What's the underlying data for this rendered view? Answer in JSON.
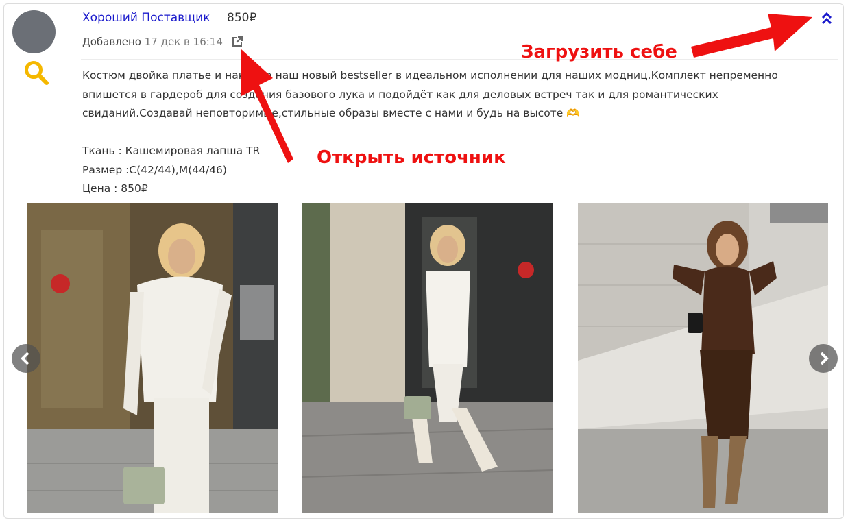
{
  "post": {
    "supplier_name": "Хороший Поставщик",
    "price": "850₽",
    "added_label": "Добавлено",
    "added_date": "17 дек в 16:14",
    "description_lines": [
      "Костюм двойка платье и накидка наш новый bestseller в идеальном исполнении для наших модниц.Комплект непременно",
      "впишется в гардероб для создания базового лука и подойдёт как для деловых встреч так и для романтических",
      "свиданий.Создавай неповторимые,стильные образы вместе с нами и будь на высоте 🫶",
      "",
      "Ткань : Кашемировая лапша TR",
      "Размер :С(42/44),М(44/46)",
      "Цена : 850₽"
    ]
  },
  "photos": [
    {
      "name": "photo-white-suit-front",
      "outfit_color": "#f2f0ea",
      "bag_color": "#a9b39a",
      "bg_color": "#6e5a3a"
    },
    {
      "name": "photo-white-suit-walking",
      "outfit_color": "#f4f2ec",
      "bag_color": "#a2ad93",
      "bg_color": "#5d6b4d"
    },
    {
      "name": "photo-brown-suit",
      "outfit_color": "#4a2a1a",
      "bag_color": "#1a1a1a",
      "bg_color": "#c9c7c2"
    }
  ],
  "annotations": {
    "upload": "Загрузить себе",
    "open_source": "Открыть источник"
  },
  "colors": {
    "link": "#1a1acc",
    "search_icon": "#f5b800",
    "annotation": "#ee1111"
  }
}
